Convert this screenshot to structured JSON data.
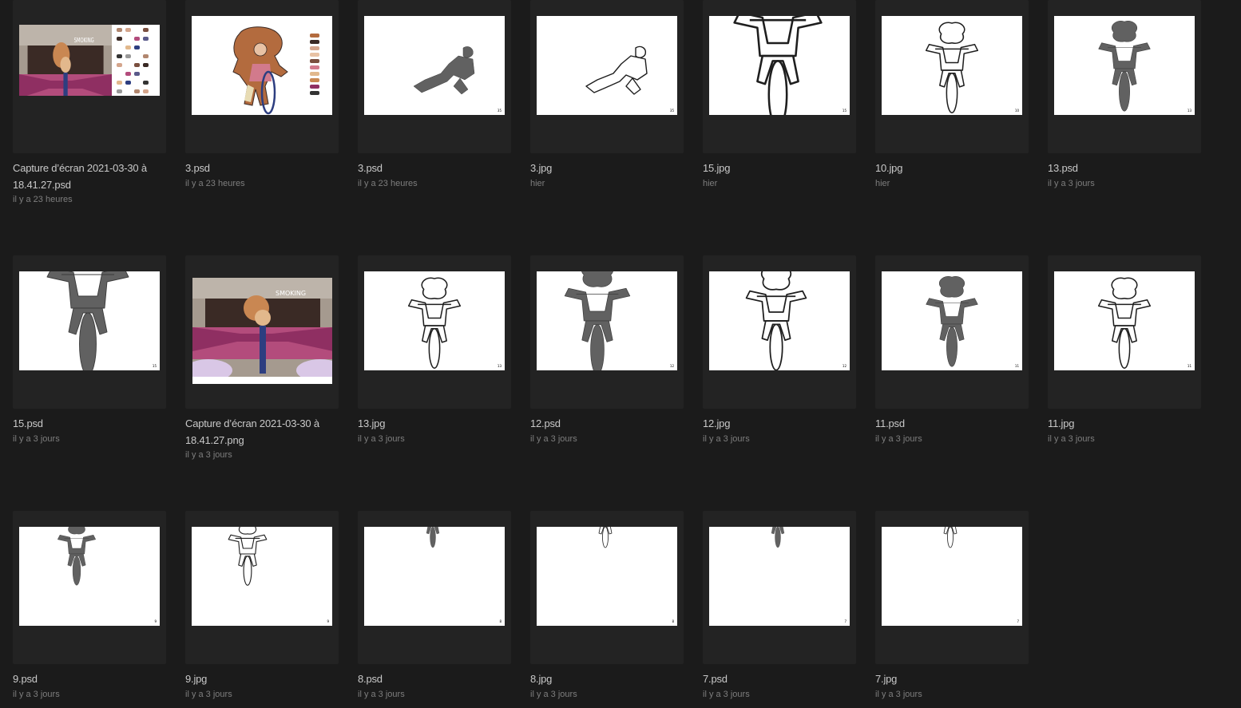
{
  "files": [
    {
      "name": "Capture d’écran 2021-03-30 à 18.41.27.psd",
      "date": "il y a 23 heures",
      "thumb": "color-screenshot-palette",
      "frame_label": ""
    },
    {
      "name": "3.psd",
      "date": "il y a 23 heures",
      "thumb": "color-character-palette",
      "frame_label": ""
    },
    {
      "name": "3.psd",
      "date": "il y a 23 heures",
      "thumb": "gray-silhouette-crouch",
      "frame_label": "35"
    },
    {
      "name": "3.jpg",
      "date": "hier",
      "thumb": "line-sketch-crouch",
      "frame_label": "35"
    },
    {
      "name": "15.jpg",
      "date": "hier",
      "thumb": "line-sketch-bike-closeup",
      "frame_label": "15"
    },
    {
      "name": "10.jpg",
      "date": "hier",
      "thumb": "line-sketch-bike",
      "frame_label": "10"
    },
    {
      "name": "13.psd",
      "date": "il y a 3 jours",
      "thumb": "gray-silhouette-bike",
      "frame_label": "13"
    },
    {
      "name": "15.psd",
      "date": "il y a 3 jours",
      "thumb": "gray-silhouette-bike-closeup",
      "frame_label": "15"
    },
    {
      "name": "Capture d’écran 2021-03-30 à 18.41.27.png",
      "date": "il y a 3 jours",
      "thumb": "color-screenshot",
      "frame_label": ""
    },
    {
      "name": "13.jpg",
      "date": "il y a 3 jours",
      "thumb": "line-sketch-bike",
      "frame_label": "13"
    },
    {
      "name": "12.psd",
      "date": "il y a 3 jours",
      "thumb": "gray-silhouette-bike-wide",
      "frame_label": "12"
    },
    {
      "name": "12.jpg",
      "date": "il y a 3 jours",
      "thumb": "line-sketch-bike-wide",
      "frame_label": "12"
    },
    {
      "name": "11.psd",
      "date": "il y a 3 jours",
      "thumb": "gray-silhouette-bike",
      "frame_label": "11"
    },
    {
      "name": "11.jpg",
      "date": "il y a 3 jours",
      "thumb": "line-sketch-bike",
      "frame_label": "11"
    },
    {
      "name": "9.psd",
      "date": "il y a 3 jours",
      "thumb": "gray-silhouette-small",
      "frame_label": "9"
    },
    {
      "name": "9.jpg",
      "date": "il y a 3 jours",
      "thumb": "line-sketch-small",
      "frame_label": "9"
    },
    {
      "name": "8.psd",
      "date": "il y a 3 jours",
      "thumb": "gray-silhouette-top",
      "frame_label": "8"
    },
    {
      "name": "8.jpg",
      "date": "il y a 3 jours",
      "thumb": "line-sketch-top",
      "frame_label": "8"
    },
    {
      "name": "7.psd",
      "date": "il y a 3 jours",
      "thumb": "gray-silhouette-top",
      "frame_label": "7"
    },
    {
      "name": "7.jpg",
      "date": "il y a 3 jours",
      "thumb": "line-sketch-top",
      "frame_label": "7"
    }
  ]
}
